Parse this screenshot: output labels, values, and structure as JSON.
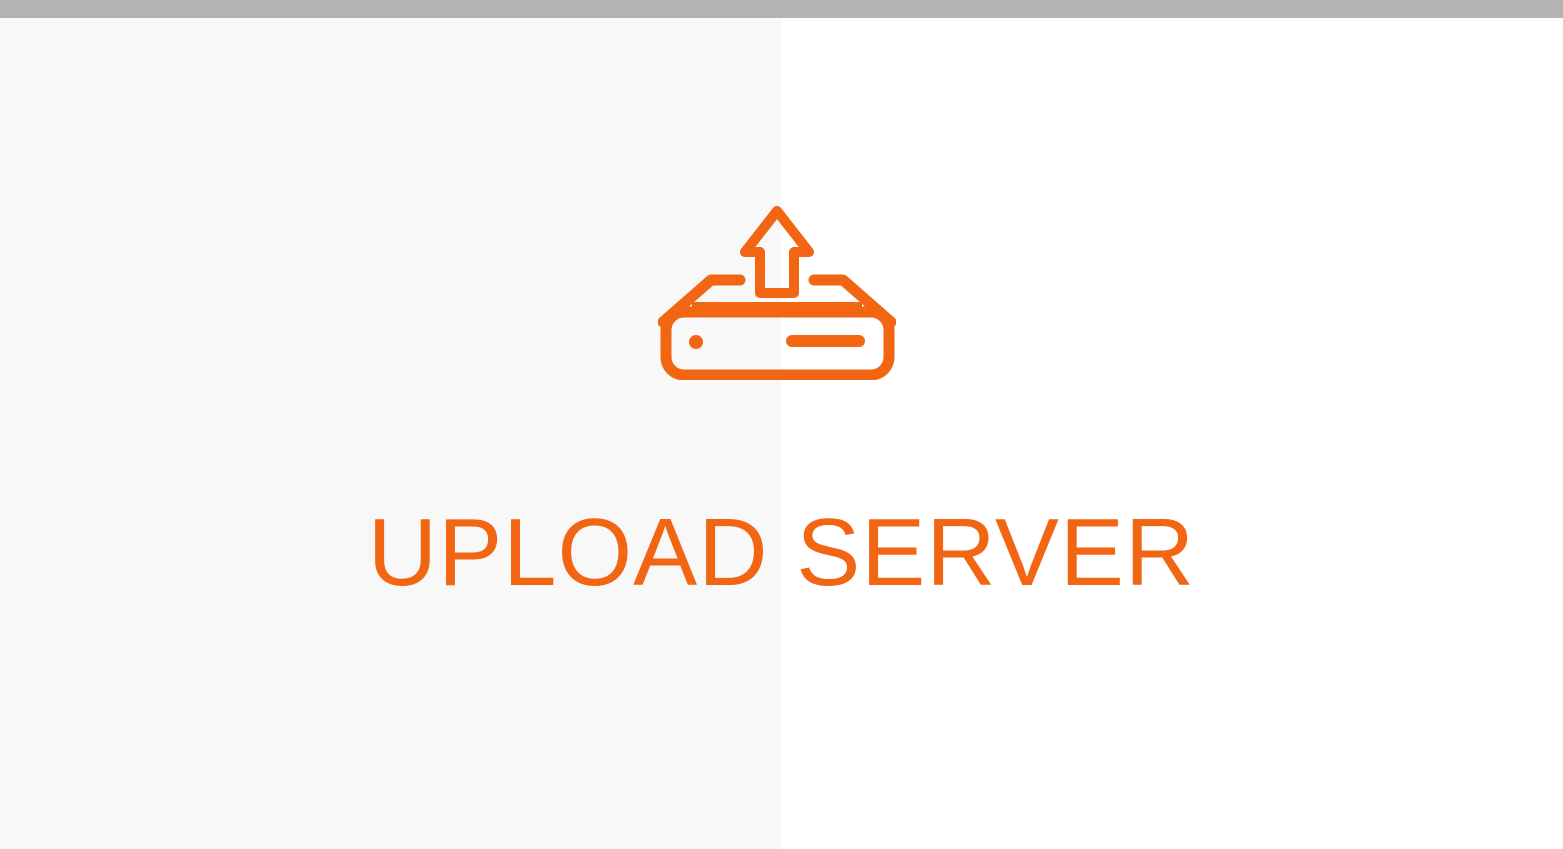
{
  "colors": {
    "accent": "#f26513",
    "top_bar": "#b3b3b3",
    "left_panel": "#f8f8f8",
    "right_panel": "#ffffff"
  },
  "icon": {
    "name": "upload-server-icon"
  },
  "title": "UPLOAD SERVER"
}
